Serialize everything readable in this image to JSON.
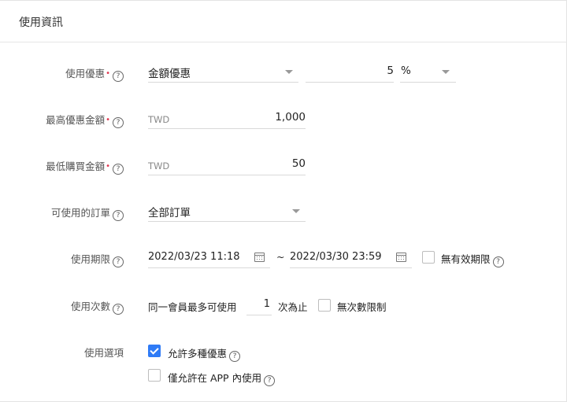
{
  "panel": {
    "title": "使用資訊"
  },
  "help_glyph": "?",
  "required_mark": "•",
  "usage_discount": {
    "label": "使用優惠",
    "type_value": "金額優惠",
    "amount": "5",
    "unit_value": "%"
  },
  "max_discount": {
    "label": "最高優惠金額",
    "currency": "TWD",
    "value": "1,000"
  },
  "min_purchase": {
    "label": "最低購買金額",
    "currency": "TWD",
    "value": "50"
  },
  "orders": {
    "label": "可使用的訂單",
    "value": "全部訂單"
  },
  "period": {
    "label": "使用期限",
    "start": "2022/03/23 11:18",
    "separator": "~",
    "end": "2022/03/30 23:59",
    "no_limit_label": "無有效期限",
    "no_limit_checked": false
  },
  "usage_count": {
    "label": "使用次數",
    "prefix": "同一會員最多可使用",
    "value": "1",
    "suffix": "次為止",
    "unlimited_label": "無次數限制",
    "unlimited_checked": false
  },
  "options": {
    "label": "使用選項",
    "items": [
      {
        "label": "允許多種優惠",
        "checked": true
      },
      {
        "label": "僅允許在 APP 內使用",
        "checked": false
      }
    ]
  },
  "colors": {
    "accent": "#2f7bf6",
    "required": "#e0364f"
  }
}
